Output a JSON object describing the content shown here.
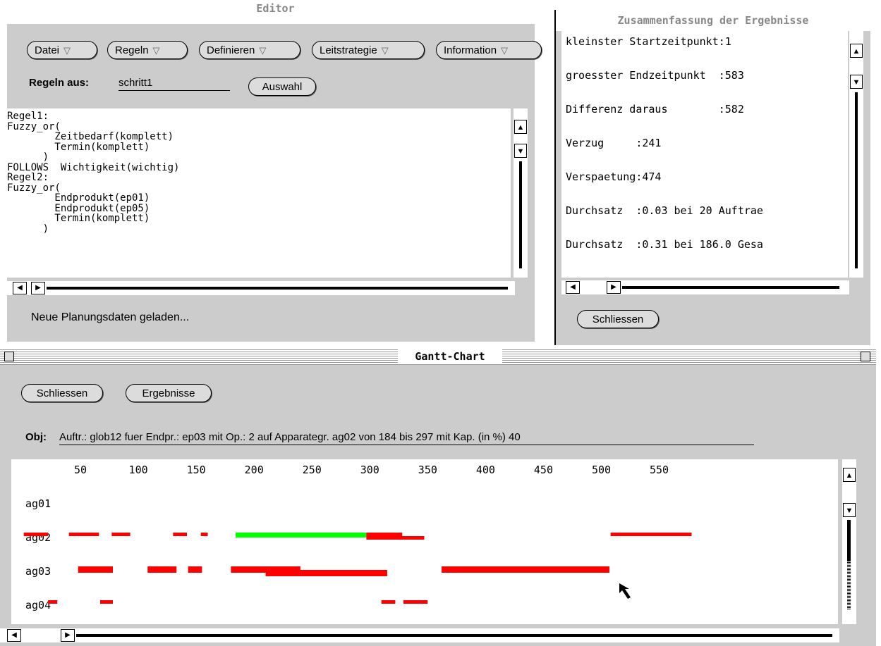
{
  "editor": {
    "title": "Editor",
    "menus": [
      {
        "label": "Datei"
      },
      {
        "label": "Regeln"
      },
      {
        "label": "Definieren"
      },
      {
        "label": "Leitstrategie"
      },
      {
        "label": "Information"
      }
    ],
    "rules_label": "Regeln aus:",
    "rules_value": "schritt1",
    "select_button": "Auswahl",
    "content": "Regel1:\nFuzzy_or(\n        Zeitbedarf(komplett)\n        Termin(komplett)\n      )\nFOLLOWS  Wichtigkeit(wichtig)\nRegel2:\nFuzzy_or(\n        Endprodukt(ep01)\n        Endprodukt(ep05)\n        Termin(komplett)\n      )",
    "status": "Neue Planungsdaten geladen..."
  },
  "summary": {
    "title": "Zusammenfassung der Ergebnisse",
    "lines": [
      "kleinster Startzeitpunkt:1",
      "groesster Endzeitpunkt  :583",
      "Differenz daraus        :582",
      "Verzug     :241",
      "Verspaetung:474",
      "Durchsatz  :0.03 bei 20 Auftrae",
      "Durchsatz  :0.31 bei 186.0 Gesa"
    ],
    "close_button": "Schliessen"
  },
  "gantt": {
    "title": "Gantt-Chart",
    "close_button": "Schliessen",
    "results_button": "Ergebnisse",
    "obj_label": "Obj:",
    "obj_value": "Auftr.: glob12 fuer Endpr.: ep03 mit Op.: 2 auf Apparategr. ag02 von 184 bis 297 mit Kap. (in %) 40",
    "colors": {
      "normal": "#ff0000",
      "selected": "#00ff00"
    }
  },
  "chart_data": {
    "type": "gantt",
    "x_ticks": [
      50,
      100,
      150,
      200,
      250,
      300,
      350,
      400,
      450,
      500,
      550
    ],
    "rows": [
      "ag01",
      "ag02",
      "ag03",
      "ag04"
    ],
    "tasks": [
      {
        "row": "ag02",
        "start": 1,
        "end": 22
      },
      {
        "row": "ag02",
        "start": 40,
        "end": 66
      },
      {
        "row": "ag02",
        "start": 77,
        "end": 93
      },
      {
        "row": "ag02",
        "start": 130,
        "end": 142
      },
      {
        "row": "ag02",
        "start": 154,
        "end": 160
      },
      {
        "row": "ag02",
        "start": 184,
        "end": 297,
        "selected": true
      },
      {
        "row": "ag02",
        "start": 297,
        "end": 328
      },
      {
        "row": "ag02",
        "start": 297,
        "end": 347
      },
      {
        "row": "ag02",
        "start": 508,
        "end": 578
      },
      {
        "row": "ag03",
        "start": 48,
        "end": 78
      },
      {
        "row": "ag03",
        "start": 108,
        "end": 133
      },
      {
        "row": "ag03",
        "start": 143,
        "end": 155
      },
      {
        "row": "ag03",
        "start": 180,
        "end": 240
      },
      {
        "row": "ag03",
        "start": 210,
        "end": 265
      },
      {
        "row": "ag03",
        "start": 240,
        "end": 280
      },
      {
        "row": "ag03",
        "start": 270,
        "end": 315
      },
      {
        "row": "ag03",
        "start": 362,
        "end": 507
      },
      {
        "row": "ag04",
        "start": 22,
        "end": 30
      },
      {
        "row": "ag04",
        "start": 67,
        "end": 78
      },
      {
        "row": "ag04",
        "start": 310,
        "end": 322
      },
      {
        "row": "ag04",
        "start": 329,
        "end": 350
      }
    ]
  }
}
